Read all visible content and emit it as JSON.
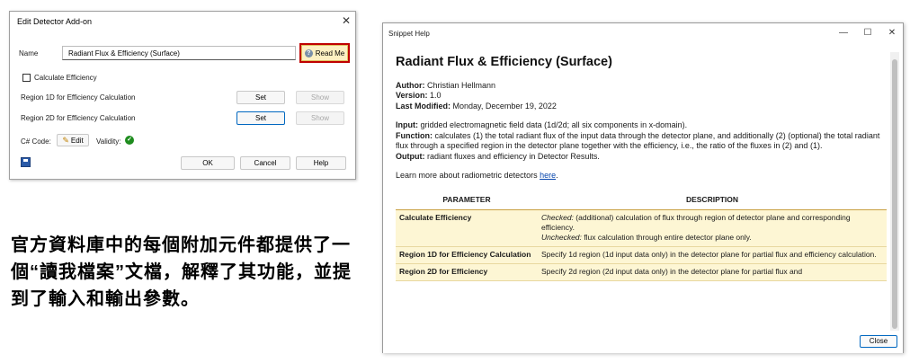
{
  "dialog": {
    "title": "Edit Detector Add-on",
    "close_glyph": "✕",
    "name_label": "Name",
    "name_value": "Radiant Flux & Efficiency (Surface)",
    "readme_label": "Read Me",
    "calc_eff_label": "Calculate Efficiency",
    "calc_eff_checked": false,
    "region1d_label": "Region 1D for Efficiency Calculation",
    "region2d_label": "Region 2D for Efficiency Calculation",
    "set_label": "Set",
    "show_label": "Show",
    "csharp_label": "C# Code:",
    "edit_label": "Edit",
    "validity_label": "Validity:",
    "ok_label": "OK",
    "cancel_label": "Cancel",
    "help_label": "Help"
  },
  "caption": "官方資料庫中的每個附加元件都提供了一個“讀我檔案”文檔，解釋了其功能，並提到了輸入和輸出參數。",
  "help_window": {
    "title": "Snippet Help",
    "heading": "Radiant Flux & Efficiency (Surface)",
    "author_label": "Author:",
    "author": "Christian Hellmann",
    "version_label": "Version:",
    "version": "1.0",
    "modified_label": "Last Modified:",
    "modified": "Monday, December 19, 2022",
    "input_label": "Input:",
    "input": "gridded electromagnetic field data (1d/2d; all six components in x-domain).",
    "function_label": "Function:",
    "function": "calculates (1) the total radiant flux of the input data through the detector plane, and additionally (2) (optional) the total radiant flux through a specified region in the detector plane together with the efficiency, i.e., the ratio of the fluxes in (2) and (1).",
    "output_label": "Output:",
    "output": "radiant fluxes and efficiency in Detector Results.",
    "learn_more": "Learn more about radiometric detectors",
    "learn_more_link": "here",
    "table": {
      "headers": [
        "PARAMETER",
        "DESCRIPTION"
      ],
      "rows": [
        {
          "param": "Calculate Efficiency",
          "checked_label": "Checked:",
          "checked_text": "(additional) calculation of flux through region of detector plane and corresponding efficiency.",
          "unchecked_label": "Unchecked:",
          "unchecked_text": "flux calculation through entire detector plane only."
        },
        {
          "param": "Region 1D for Efficiency Calculation",
          "desc": "Specify 1d region (1d input data only) in the detector plane for partial flux and efficiency calculation."
        },
        {
          "param": "Region 2D for Efficiency",
          "desc": "Specify 2d region (2d input data only) in the detector plane for partial flux and"
        }
      ]
    },
    "close_label": "Close"
  }
}
